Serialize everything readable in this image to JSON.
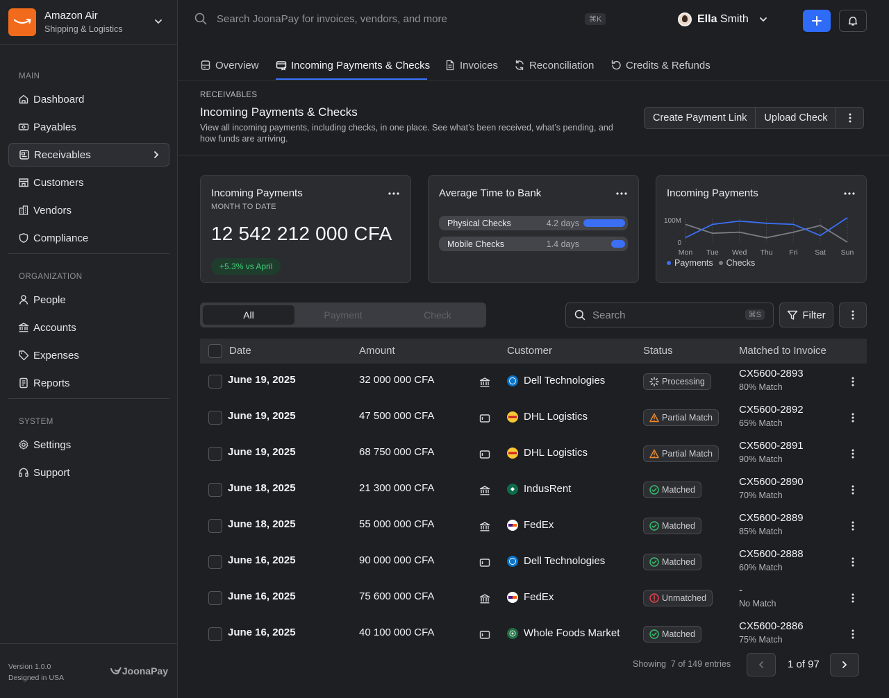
{
  "org": {
    "name": "Amazon Air",
    "subtitle": "Shipping & Logistics"
  },
  "sidebar": {
    "sections": [
      {
        "label": "MAIN"
      },
      {
        "label": "ORGANIZATION"
      },
      {
        "label": "SYSTEM"
      }
    ],
    "items": [
      {
        "label": "Dashboard",
        "icon": "home-icon"
      },
      {
        "label": "Payables",
        "icon": "payables-icon"
      },
      {
        "label": "Receivables",
        "icon": "receivables-icon",
        "active": true
      },
      {
        "label": "Customers",
        "icon": "store-icon"
      },
      {
        "label": "Vendors",
        "icon": "building-icon"
      },
      {
        "label": "Compliance",
        "icon": "shield-icon"
      },
      {
        "label": "People",
        "icon": "user-icon"
      },
      {
        "label": "Accounts",
        "icon": "bank-icon"
      },
      {
        "label": "Expenses",
        "icon": "tag-icon"
      },
      {
        "label": "Reports",
        "icon": "report-icon"
      },
      {
        "label": "Settings",
        "icon": "gear-icon"
      },
      {
        "label": "Support",
        "icon": "headset-icon"
      }
    ],
    "footer": {
      "version": "Version 1.0.0",
      "designed": "Designed in USA",
      "brand": "JoonaPay"
    }
  },
  "topbar": {
    "search_placeholder": "Search JoonaPay for invoices, vendors, and more",
    "shortcut": "⌘K",
    "user_first": "Ella",
    "user_last": "Smith"
  },
  "tabs": [
    {
      "label": "Overview"
    },
    {
      "label": "Incoming Payments & Checks",
      "active": true
    },
    {
      "label": "Invoices"
    },
    {
      "label": "Reconciliation"
    },
    {
      "label": "Credits & Refunds"
    }
  ],
  "header": {
    "eyebrow": "RECEIVABLES",
    "title": "Incoming Payments & Checks",
    "description": "View all incoming payments, including checks, in one place. See what’s been received, what’s pending, and how funds are arriving.",
    "actions": [
      "Create Payment Link",
      "Upload Check"
    ]
  },
  "cards": {
    "payments": {
      "title": "Incoming Payments",
      "subtitle": "MONTH TO DATE",
      "value": "12 542 212 000 CFA",
      "delta": "+5.3% vs April"
    },
    "avg_time": {
      "title": "Average Time to Bank",
      "rows": [
        {
          "label": "Physical Checks",
          "value": "4.2 days",
          "fill": 1.0
        },
        {
          "label": "Mobile Checks",
          "value": "1.4 days",
          "fill": 0.333
        }
      ]
    },
    "chart": {
      "title": "Incoming Payments"
    }
  },
  "chart_data": {
    "type": "line",
    "title": "Incoming Payments",
    "categories": [
      "Mon",
      "Tue",
      "Wed",
      "Thu",
      "Fri",
      "Sat",
      "Sun"
    ],
    "y_ticks": [
      "100M",
      "0"
    ],
    "ylim": [
      0,
      100
    ],
    "series": [
      {
        "name": "Payments",
        "color": "#3b6ff4",
        "values": [
          20,
          80,
          95,
          85,
          80,
          30,
          110
        ]
      },
      {
        "name": "Checks",
        "color": "#7b7e84",
        "values": [
          80,
          40,
          45,
          20,
          45,
          75,
          0
        ]
      }
    ],
    "legend": "bottom-left"
  },
  "filters": {
    "segments": [
      "All",
      "Payment",
      "Check"
    ],
    "active_segment": "All",
    "search_placeholder": "Search",
    "search_shortcut": "⌘S",
    "filter_label": "Filter"
  },
  "table": {
    "columns": [
      "Date",
      "Amount",
      "Customer",
      "Status",
      "Matched to Invoice"
    ],
    "rows": [
      {
        "date": "June 19, 2025",
        "amount": "32 000 000 CFA",
        "method": "bank-icon",
        "customer": "Dell Technologies",
        "logo": "dell",
        "status": "Processing",
        "status_icon": "spinner-icon",
        "invoice": "CX5600-2893",
        "match": "80% Match"
      },
      {
        "date": "June 19, 2025",
        "amount": "47 500 000 CFA",
        "method": "check-icon",
        "customer": "DHL Logistics",
        "logo": "dhl",
        "status": "Partial Match",
        "status_icon": "warning-icon",
        "invoice": "CX5600-2892",
        "match": "65% Match"
      },
      {
        "date": "June 19, 2025",
        "amount": "68 750 000 CFA",
        "method": "check-icon",
        "customer": "DHL Logistics",
        "logo": "dhl",
        "status": "Partial Match",
        "status_icon": "warning-icon",
        "invoice": "CX5600-2891",
        "match": "90% Match"
      },
      {
        "date": "June 18, 2025",
        "amount": "21 300 000 CFA",
        "method": "bank-icon",
        "customer": "IndusRent",
        "logo": "indus",
        "status": "Matched",
        "status_icon": "check-circle-icon",
        "invoice": "CX5600-2890",
        "match": "70% Match"
      },
      {
        "date": "June 18, 2025",
        "amount": "55 000 000 CFA",
        "method": "bank-icon",
        "customer": "FedEx",
        "logo": "fedex",
        "status": "Matched",
        "status_icon": "check-circle-icon",
        "invoice": "CX5600-2889",
        "match": "85% Match"
      },
      {
        "date": "June 16, 2025",
        "amount": "90 000 000 CFA",
        "method": "check-icon",
        "customer": "Dell Technologies",
        "logo": "dell",
        "status": "Matched",
        "status_icon": "check-circle-icon",
        "invoice": "CX5600-2888",
        "match": "60% Match"
      },
      {
        "date": "June 16, 2025",
        "amount": "75 600 000 CFA",
        "method": "bank-icon",
        "customer": "FedEx",
        "logo": "fedex",
        "status": "Unmatched",
        "status_icon": "alert-circle-icon",
        "invoice": "-",
        "match": "No Match"
      },
      {
        "date": "June 16, 2025",
        "amount": "40 100 000 CFA",
        "method": "check-icon",
        "customer": "Whole Foods Market",
        "logo": "wfm",
        "status": "Matched",
        "status_icon": "check-circle-icon",
        "invoice": "CX5600-2886",
        "match": "75% Match"
      }
    ]
  },
  "pagination": {
    "showing_prefix": "Showing",
    "showing": "7 of 149 entries",
    "page": "1 of 97"
  }
}
